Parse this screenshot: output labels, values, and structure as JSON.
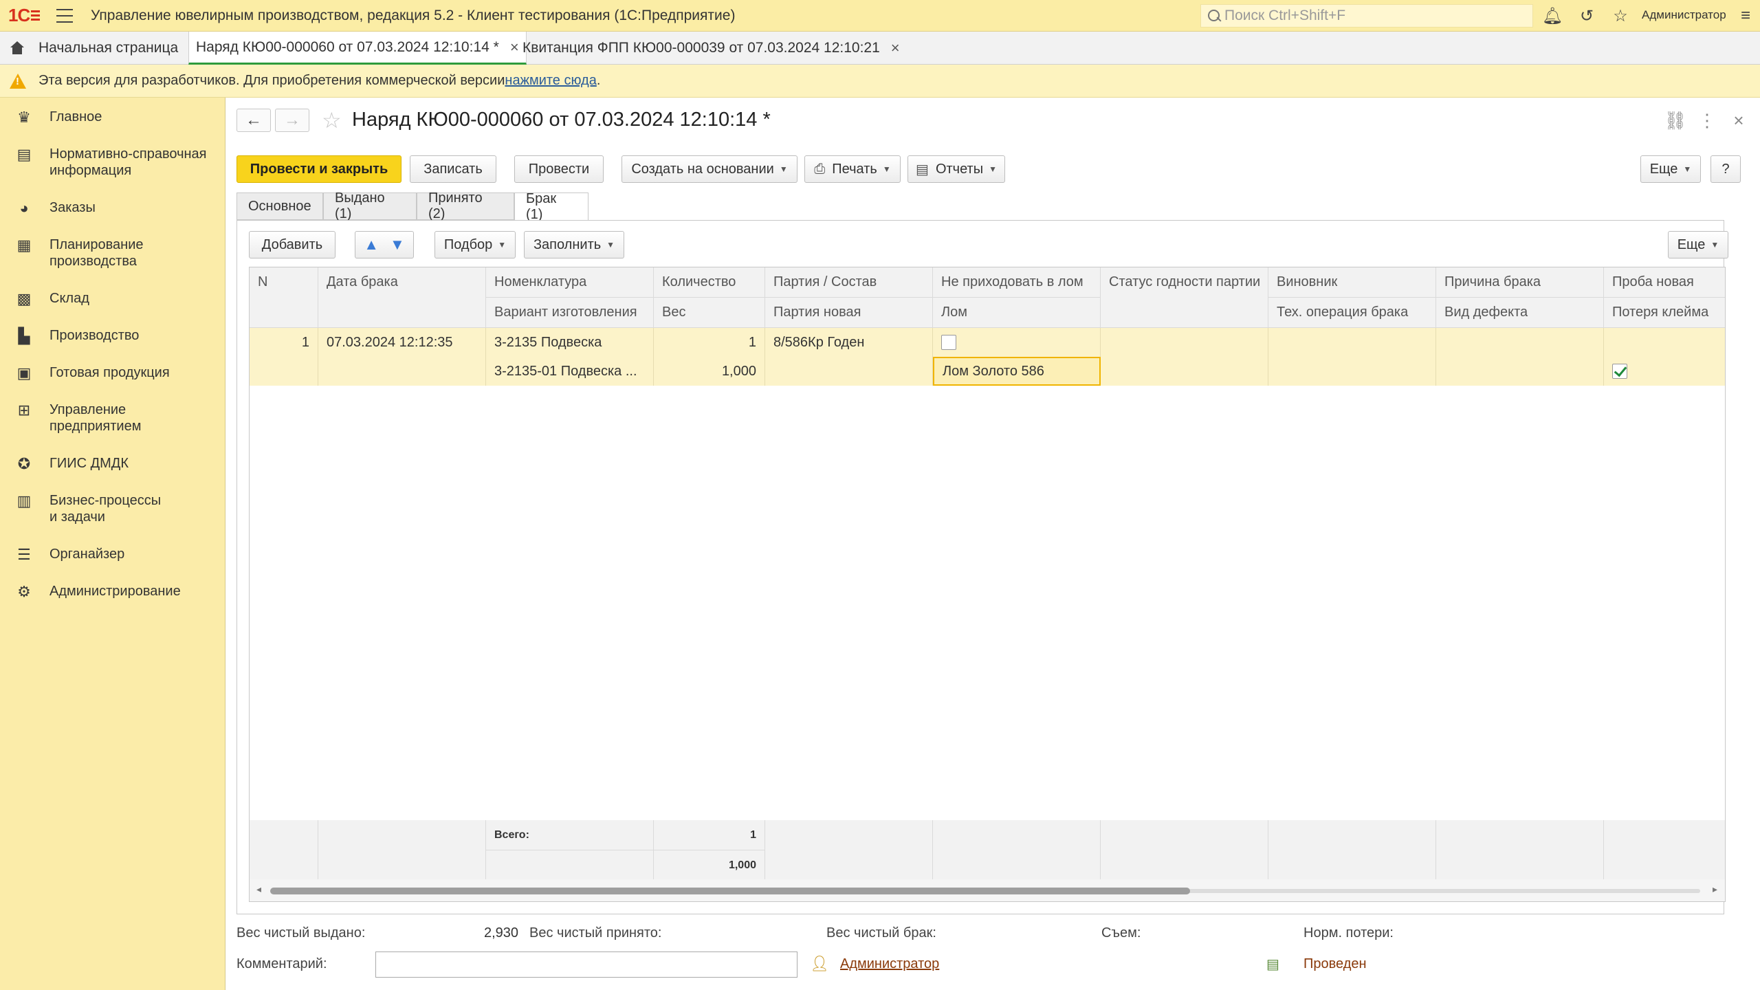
{
  "app": {
    "title": "Управление ювелирным производством, редакция 5.2  - Клиент тестирования (1С:Предприятие)",
    "logo_text": "1С",
    "search_placeholder": "Поиск Ctrl+Shift+F",
    "user": "Администратор"
  },
  "window_tabs": [
    {
      "label": "Начальная страница"
    },
    {
      "label": "Наряд КЮ00-000060 от 07.03.2024 12:10:14 *",
      "active": true
    },
    {
      "label": "Квитанция ФПП КЮ00-000039 от 07.03.2024 12:10:21"
    }
  ],
  "warning": {
    "text": "Эта версия для разработчиков. Для приобретения коммерческой версии ",
    "link": "нажмите сюда",
    "suffix": "."
  },
  "sidebar": {
    "items": [
      {
        "label": "Главное",
        "icon": "crown-icon"
      },
      {
        "label": "Нормативно-справочная\nинформация",
        "icon": "book-icon"
      },
      {
        "label": "Заказы",
        "icon": "pie-chart-icon"
      },
      {
        "label": "Планирование\nпроизводства",
        "icon": "clipboard-icon"
      },
      {
        "label": "Склад",
        "icon": "grid-icon"
      },
      {
        "label": "Производство",
        "icon": "factory-icon"
      },
      {
        "label": "Готовая продукция",
        "icon": "briefcase-icon"
      },
      {
        "label": "Управление\nпредприятием",
        "icon": "org-chart-icon"
      },
      {
        "label": "ГИИС ДМДК",
        "icon": "medal-icon"
      },
      {
        "label": "Бизнес-процессы\nи задачи",
        "icon": "building-icon"
      },
      {
        "label": "Органайзер",
        "icon": "organizer-icon"
      },
      {
        "label": "Администрирование",
        "icon": "gear-icon"
      }
    ]
  },
  "form": {
    "title": "Наряд КЮ00-000060 от 07.03.2024 12:10:14 *",
    "toolbar": {
      "post_close": "Провести и закрыть",
      "save": "Записать",
      "post": "Провести",
      "create_based": "Создать на основании",
      "print": "Печать",
      "reports": "Отчеты",
      "more": "Еще",
      "help": "?"
    },
    "tabs": [
      {
        "label": "Основное"
      },
      {
        "label": "Выдано (1)"
      },
      {
        "label": "Принято (2)"
      },
      {
        "label": "Брак (1)",
        "active": true
      }
    ],
    "table_toolbar": {
      "add": "Добавить",
      "pick": "Подбор",
      "fill": "Заполнить",
      "more": "Еще"
    },
    "table": {
      "headers_row1": [
        "N",
        "Дата брака",
        "Номенклатура",
        "Количество",
        "Партия / Состав",
        "Не приходовать в лом",
        "Статус годности партии",
        "Виновник",
        "Причина брака",
        "Проба новая"
      ],
      "headers_row2": [
        "",
        "",
        "Вариант изготовления",
        "Вес",
        "Партия новая",
        "Лом",
        "",
        "Тех. операция брака",
        "Вид дефекта",
        "Потеря клейма"
      ],
      "rows": [
        {
          "n": "1",
          "date": "07.03.2024 12:12:35",
          "nomenclature": "3-2135 Подвеска",
          "variant": "3-2135-01 Подвеска ...",
          "quantity": "1",
          "weight": "1,000",
          "batch": "8/586Кр Годен",
          "batch_new": "",
          "no_scrap": false,
          "scrap": "Лом Золото  586",
          "status": "",
          "culprit": "",
          "operation": "",
          "reason": "",
          "defect": "",
          "probe_new": "",
          "stamp_loss": true
        }
      ],
      "footer": {
        "total_label": "Всего:",
        "total_qty": "1",
        "total_weight": "1,000"
      }
    },
    "footer": {
      "net_issued_label": "Вес чистый выдано:",
      "net_issued_value": "2,930",
      "net_received_label": "Вес чистый принято:",
      "net_defect_label": "Вес чистый брак:",
      "removal_label": "Съем:",
      "norm_loss_label": "Норм. потери:",
      "comment_label": "Комментарий:",
      "comment_value": "",
      "author": "Администратор",
      "status": "Проведен"
    }
  },
  "colors": {
    "accent_yellow": "#f8d31c",
    "sidebar_bg": "#fbeca9",
    "active_tab_underline": "#2e9b3c",
    "link_brown": "#8a3a0a"
  }
}
